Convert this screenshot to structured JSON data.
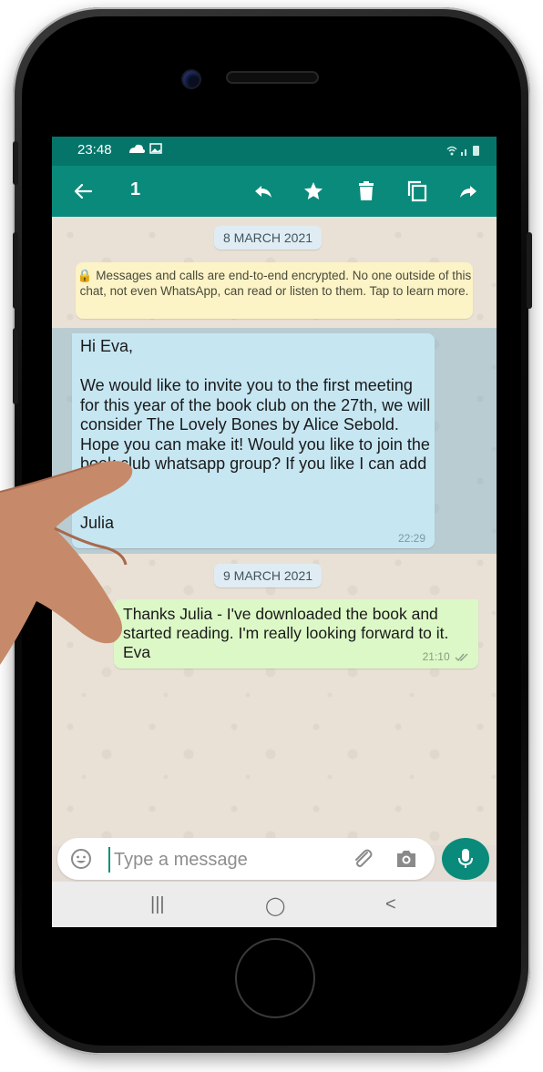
{
  "status_bar": {
    "time": "23:48"
  },
  "toolbar": {
    "back_label": "←",
    "selected_count": "1"
  },
  "chat": {
    "date_1": "8 MARCH 2021",
    "encryption_notice": "🔒 Messages and calls are end-to-end encrypted. No one outside of this chat, not even WhatsApp, can read or listen to them. Tap to learn more.",
    "incoming_message": {
      "text": "Hi Eva,\n\nWe would like to invite you to the first meeting for this year of the book club on the 27th, we will consider The Lovely Bones by Alice Sebold. Hope you can make it! Would you like to join the book club whatsapp group? If you like I can add you?\n\nJulia",
      "time": "22:29"
    },
    "date_2": "9 MARCH 2021",
    "outgoing_message": {
      "text": "Thanks Julia - I've downloaded the book and started reading. I'm really looking forward to it. Eva",
      "time": "21:10"
    }
  },
  "composer": {
    "placeholder": "Type a message"
  },
  "nav": {
    "recents": "|||",
    "home": "◯",
    "back": "<"
  },
  "colors": {
    "header": "#0a8a7b",
    "status": "#05756a",
    "incoming": "#c6e6f2",
    "outgoing": "#dcf8c6",
    "notice": "#fcf3c6"
  }
}
